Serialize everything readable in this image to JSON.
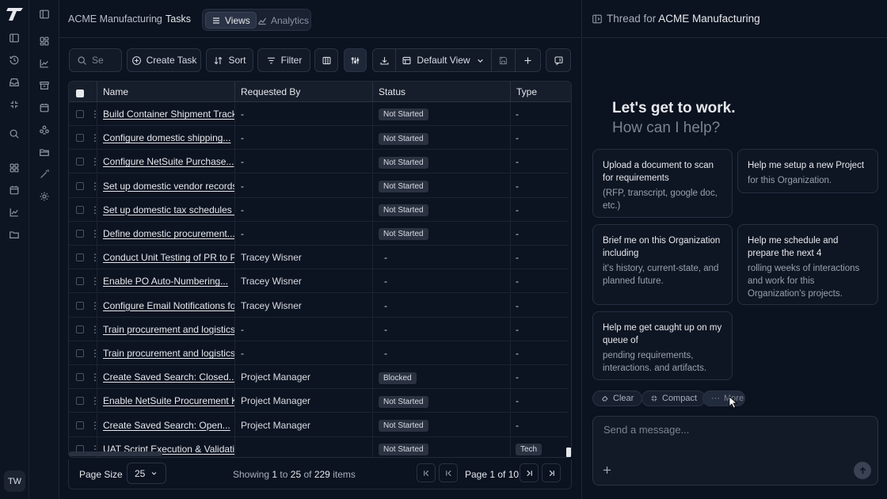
{
  "user": {
    "initials": "TW"
  },
  "header": {
    "breadcrumb": [
      "ACME Manufacturing",
      "Tasks"
    ],
    "tabs": [
      {
        "label": "Views"
      },
      {
        "label": "Analytics"
      }
    ]
  },
  "toolbar": {
    "search_placeholder": "Se",
    "create_task": "Create Task",
    "sort": "Sort",
    "filter": "Filter",
    "view": "Default View"
  },
  "table": {
    "columns": [
      "Name",
      "Requested By",
      "Status",
      "Type"
    ],
    "rows": [
      {
        "name": "Build Container Shipment Trackin...",
        "requested_by": "-",
        "status": "Not Started",
        "type": "-"
      },
      {
        "name": "Configure domestic shipping...",
        "requested_by": "-",
        "status": "Not Started",
        "type": "-"
      },
      {
        "name": "Configure NetSuite Purchase...",
        "requested_by": "-",
        "status": "Not Started",
        "type": "-"
      },
      {
        "name": "Set up domestic vendor records...",
        "requested_by": "-",
        "status": "Not Started",
        "type": "-"
      },
      {
        "name": "Set up domestic tax schedules an...",
        "requested_by": "-",
        "status": "Not Started",
        "type": "-"
      },
      {
        "name": "Define domestic procurement...",
        "requested_by": "-",
        "status": "Not Started",
        "type": "-"
      },
      {
        "name": "Conduct Unit Testing of PR to PO...",
        "requested_by": "Tracey Wisner",
        "status": "-",
        "type": "-"
      },
      {
        "name": "Enable PO Auto-Numbering...",
        "requested_by": "Tracey Wisner",
        "status": "-",
        "type": "-"
      },
      {
        "name": "Configure Email Notifications for...",
        "requested_by": "Tracey Wisner",
        "status": "-",
        "type": "-"
      },
      {
        "name": "Train procurement and logistics...",
        "requested_by": "-",
        "status": "-",
        "type": "-"
      },
      {
        "name": "Train procurement and logistics...",
        "requested_by": "-",
        "status": "-",
        "type": "-"
      },
      {
        "name": "Create Saved Search: Closed...",
        "requested_by": "Project Manager",
        "status": "Blocked",
        "type": "-"
      },
      {
        "name": "Enable NetSuite Procurement KP...",
        "requested_by": "Project Manager",
        "status": "Not Started",
        "type": "-"
      },
      {
        "name": "Create Saved Search: Open...",
        "requested_by": "Project Manager",
        "status": "Not Started",
        "type": "-"
      },
      {
        "name": "UAT Script Execution & Validatio...",
        "requested_by": "",
        "status": "Not Started",
        "type": "Tech"
      }
    ]
  },
  "pagination": {
    "page_size_label": "Page Size",
    "page_size": "25",
    "showing": "Showing",
    "from": "1",
    "to_word": "to",
    "to": "25",
    "of_word": "of",
    "total": "229",
    "items": "items",
    "page_word": "Page",
    "page": "1 of 10"
  },
  "thread": {
    "title_prefix": "Thread for",
    "org": "ACME Manufacturing",
    "greeting": "Let's get to work.",
    "subgreeting": "How can I help?",
    "cards": [
      {
        "title": "Upload a document to scan for requirements",
        "sub": "(RFP, transcript, google doc, etc.)"
      },
      {
        "title": "Help me setup a new Project",
        "sub": "for this Organization."
      },
      {
        "title": "Brief me on this Organization including",
        "sub": "it's history, current-state, and planned future."
      },
      {
        "title": "Help me schedule and prepare the next 4",
        "sub": "rolling weeks of interactions and work for this Organization's projects."
      },
      {
        "title": "Help me get caught up on my queue of",
        "sub": "pending requirements, interactions. and artifacts."
      }
    ],
    "chips": [
      "Clear",
      "Compact",
      "More"
    ],
    "message_placeholder": "Send a message..."
  }
}
